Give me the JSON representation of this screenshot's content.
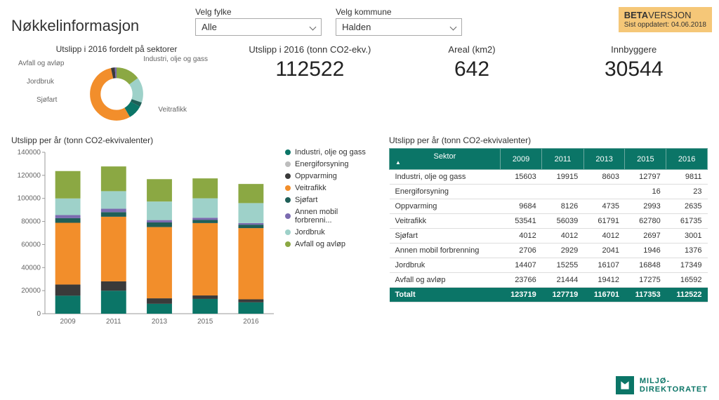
{
  "page_title": "Nøkkelinformasjon",
  "filters": {
    "fylke": {
      "label": "Velg fylke",
      "selected": "Alle"
    },
    "kommune": {
      "label": "Velg kommune",
      "selected": "Halden"
    }
  },
  "beta": {
    "bold": "BETA",
    "rest": "VERSJON",
    "updated": "Sist oppdatert: 04.06.2018"
  },
  "donut": {
    "title": "Utslipp i 2016 fordelt på sektorer",
    "labels": {
      "avfall": "Avfall og avløp",
      "jordbruk": "Jordbruk",
      "sjofart": "Sjøfart",
      "industri": "Industri, olje og gass",
      "veitrafikk": "Veitrafikk"
    }
  },
  "kpis": {
    "utslipp": {
      "label": "Utslipp i 2016 (tonn CO2-ekv.)",
      "value": "112522"
    },
    "areal": {
      "label": "Areal (km2)",
      "value": "642"
    },
    "innbyggere": {
      "label": "Innbyggere",
      "value": "30544"
    }
  },
  "bar_chart": {
    "title": "Utslipp per år (tonn CO2-ekvivalenter)",
    "legend": [
      "Industri, olje og gass",
      "Energiforsyning",
      "Oppvarming",
      "Veitrafikk",
      "Sjøfart",
      "Annen mobil forbrenni...",
      "Jordbruk",
      "Avfall og avløp"
    ]
  },
  "table": {
    "title": "Utslipp per år (tonn CO2-ekvivalenter)",
    "headers": [
      "Sektor",
      "2009",
      "2011",
      "2013",
      "2015",
      "2016"
    ],
    "rows": [
      [
        "Industri, olje og gass",
        "15603",
        "19915",
        "8603",
        "12797",
        "9811"
      ],
      [
        "Energiforsyning",
        "",
        "",
        "",
        "16",
        "23"
      ],
      [
        "Oppvarming",
        "9684",
        "8126",
        "4735",
        "2993",
        "2635"
      ],
      [
        "Veitrafikk",
        "53541",
        "56039",
        "61791",
        "62780",
        "61735"
      ],
      [
        "Sjøfart",
        "4012",
        "4012",
        "4012",
        "2697",
        "3001"
      ],
      [
        "Annen mobil forbrenning",
        "2706",
        "2929",
        "2041",
        "1946",
        "1376"
      ],
      [
        "Jordbruk",
        "14407",
        "15255",
        "16107",
        "16848",
        "17349"
      ],
      [
        "Avfall og avløp",
        "23766",
        "21444",
        "19412",
        "17275",
        "16592"
      ]
    ],
    "total": [
      "Totalt",
      "123719",
      "127719",
      "116701",
      "117353",
      "112522"
    ]
  },
  "logo": {
    "line1": "MILJØ-",
    "line2": "DIREKTORATET"
  },
  "colors": {
    "industri": "#0b7567",
    "energi": "#bdbdbd",
    "oppvarming": "#3a3a3a",
    "veitrafikk": "#f28e2b",
    "sjofart": "#1f5f57",
    "annen": "#7b6bb0",
    "jordbruk": "#9ed1c9",
    "avfall": "#8ba843"
  },
  "chart_data": {
    "type": "bar",
    "stacked": true,
    "title": "Utslipp per år (tonn CO2-ekvivalenter)",
    "xlabel": "",
    "ylabel": "",
    "ylim": [
      0,
      140000
    ],
    "yticks": [
      0,
      20000,
      40000,
      60000,
      80000,
      100000,
      120000,
      140000
    ],
    "categories": [
      "2009",
      "2011",
      "2013",
      "2015",
      "2016"
    ],
    "series": [
      {
        "name": "Industri, olje og gass",
        "color": "#0b7567",
        "values": [
          15603,
          19915,
          8603,
          12797,
          9811
        ]
      },
      {
        "name": "Energiforsyning",
        "color": "#bdbdbd",
        "values": [
          0,
          0,
          0,
          16,
          23
        ]
      },
      {
        "name": "Oppvarming",
        "color": "#3a3a3a",
        "values": [
          9684,
          8126,
          4735,
          2993,
          2635
        ]
      },
      {
        "name": "Veitrafikk",
        "color": "#f28e2b",
        "values": [
          53541,
          56039,
          61791,
          62780,
          61735
        ]
      },
      {
        "name": "Sjøfart",
        "color": "#1f5f57",
        "values": [
          4012,
          4012,
          4012,
          2697,
          3001
        ]
      },
      {
        "name": "Annen mobil forbrenning",
        "color": "#7b6bb0",
        "values": [
          2706,
          2929,
          2041,
          1946,
          1376
        ]
      },
      {
        "name": "Jordbruk",
        "color": "#9ed1c9",
        "values": [
          14407,
          15255,
          16107,
          16848,
          17349
        ]
      },
      {
        "name": "Avfall og avløp",
        "color": "#8ba843",
        "values": [
          23766,
          21444,
          19412,
          17275,
          16592
        ]
      }
    ],
    "donut": {
      "type": "pie",
      "title": "Utslipp i 2016 fordelt på sektorer",
      "slices": [
        {
          "name": "Avfall og avløp",
          "value": 16592,
          "color": "#8ba843"
        },
        {
          "name": "Jordbruk",
          "value": 17349,
          "color": "#9ed1c9"
        },
        {
          "name": "Sjøfart",
          "value": 3001,
          "color": "#1f5f57"
        },
        {
          "name": "Industri, olje og gass",
          "value": 9811,
          "color": "#0b7567"
        },
        {
          "name": "Veitrafikk",
          "value": 61735,
          "color": "#f28e2b"
        },
        {
          "name": "Oppvarming",
          "value": 2635,
          "color": "#3a3a3a"
        },
        {
          "name": "Annen mobil forbrenning",
          "value": 1376,
          "color": "#7b6bb0"
        }
      ]
    }
  }
}
